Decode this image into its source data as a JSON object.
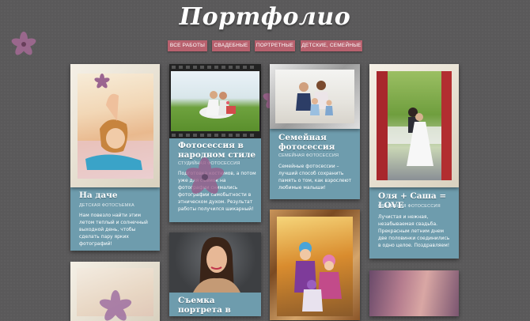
{
  "page": {
    "title": "Портфолио"
  },
  "filters": [
    {
      "label": "Все работы"
    },
    {
      "label": "Свадебные"
    },
    {
      "label": "Портретные"
    },
    {
      "label": "Детские, семейные"
    }
  ],
  "cards": [
    {
      "title": "На даче",
      "subtitle": "Детская фотосъемка",
      "description": "Нам повезло найти этим летом теплый и солнечный выходной день, чтобы сделать пару ярких фотографий!"
    },
    {
      "title": "Фотосессия в народном стиле",
      "subtitle": "Студийная фотосессия",
      "description": "Подготовка костюмов, а потом уже для съемок на фотографии снимались фотографии самобытности в этническом духом. Результат работы получился шикарный!"
    },
    {
      "title": "Семейная фотосессия",
      "subtitle": "Семейная фотосессия",
      "description": "Семейные фотосессии – лучший способ сохранить память о том, как взрослеют любимые малыши!"
    },
    {
      "title": "Оля + Саша = LOVE",
      "subtitle": "Свадебная фотосессия",
      "description": "Лучистая и нежная, незабываемая свадьба. Прекрасным летним днем две половинки соединились в одно целое. Поздравляем!"
    },
    {
      "title": "Съемка портрета в студии",
      "subtitle": "",
      "description": ""
    }
  ]
}
